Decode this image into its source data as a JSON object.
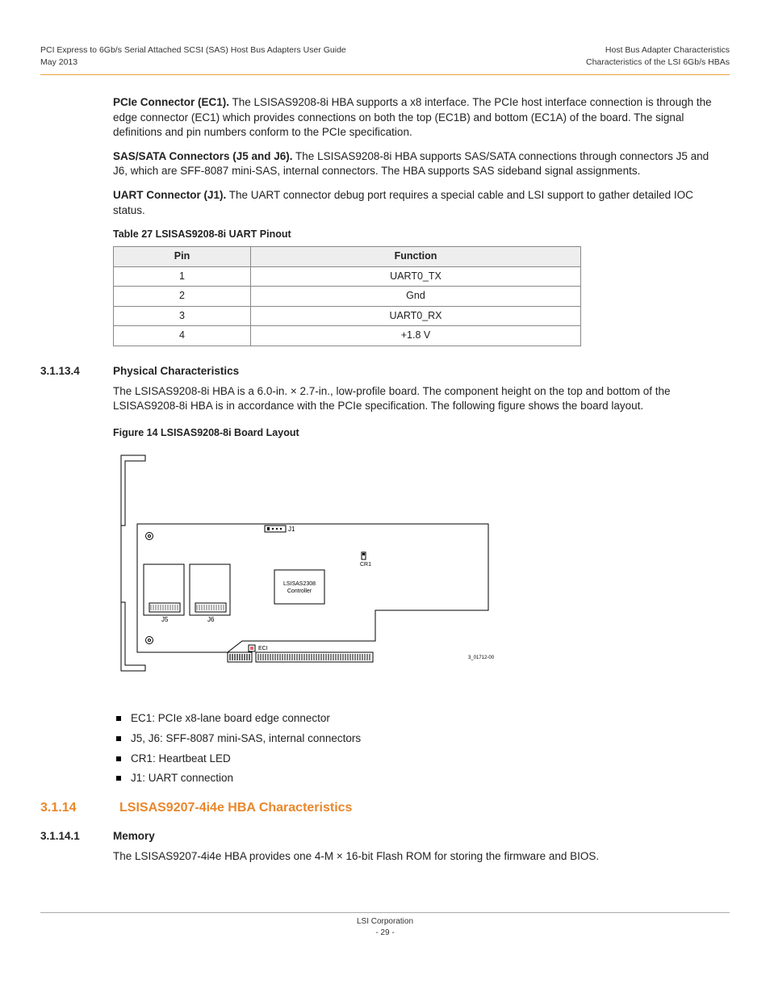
{
  "header": {
    "left_line1": "PCI Express to 6Gb/s Serial Attached SCSI (SAS) Host Bus Adapters User Guide",
    "left_line2": "May 2013",
    "right_line1": "Host Bus Adapter Characteristics",
    "right_line2": "Characteristics of the LSI 6Gb/s HBAs"
  },
  "para_pcie": {
    "lead": "PCIe Connector (EC1).",
    "body": "  The LSISAS9208-8i HBA supports a x8 interface. The PCIe host interface connection is through the edge connector (EC1) which provides connections on both the top (EC1B) and bottom (EC1A) of the board. The signal definitions and pin numbers conform to the PCIe specification."
  },
  "para_sas": {
    "lead": "SAS/SATA Connectors (J5 and J6).",
    "body": "  The LSISAS9208-8i HBA supports SAS/SATA connections through connectors J5 and J6, which are SFF-8087 mini-SAS, internal connectors. The HBA supports SAS sideband signal assignments."
  },
  "para_uart": {
    "lead": "UART Connector (J1).",
    "body": " The UART connector debug port requires a special cable and LSI support to gather detailed IOC status."
  },
  "table27": {
    "caption": "Table 27  LSISAS9208-8i UART Pinout",
    "head": {
      "c1": "Pin",
      "c2": "Function"
    },
    "rows": [
      {
        "pin": "1",
        "func": "UART0_TX"
      },
      {
        "pin": "2",
        "func": "Gnd"
      },
      {
        "pin": "3",
        "func": "UART0_RX"
      },
      {
        "pin": "4",
        "func": "+1.8 V"
      }
    ]
  },
  "sec_3_1_13_4": {
    "num": "3.1.13.4",
    "title": "Physical Characteristics",
    "body": "The LSISAS9208-8i HBA is a 6.0-in. × 2.7-in., low-profile board. The component height on the top and bottom of the LSISAS9208-8i HBA is in accordance with the PCIe specification. The following figure shows the board layout."
  },
  "figure14": {
    "caption": "Figure 14  LSISAS9208-8i Board Layout",
    "labels": {
      "j1": "J1",
      "cr1": "CR1",
      "controller_l1": "LSISAS2308",
      "controller_l2": "Controller",
      "j5": "J5",
      "j6": "J6",
      "eci": "ECI",
      "dwg": "3_01712-00"
    }
  },
  "bullets": [
    "EC1: PCIe x8-lane board edge connector",
    "J5, J6: SFF-8087 mini-SAS, internal connectors",
    "CR1: Heartbeat LED",
    "J1: UART connection"
  ],
  "sec_3_1_14": {
    "num": "3.1.14",
    "title": "LSISAS9207-4i4e HBA Characteristics"
  },
  "sec_3_1_14_1": {
    "num": "3.1.14.1",
    "title": "Memory",
    "body": "The LSISAS9207-4i4e HBA provides one 4-M × 16-bit Flash ROM for storing the firmware and BIOS."
  },
  "footer": {
    "line1": "LSI Corporation",
    "line2": "- 29 -"
  }
}
